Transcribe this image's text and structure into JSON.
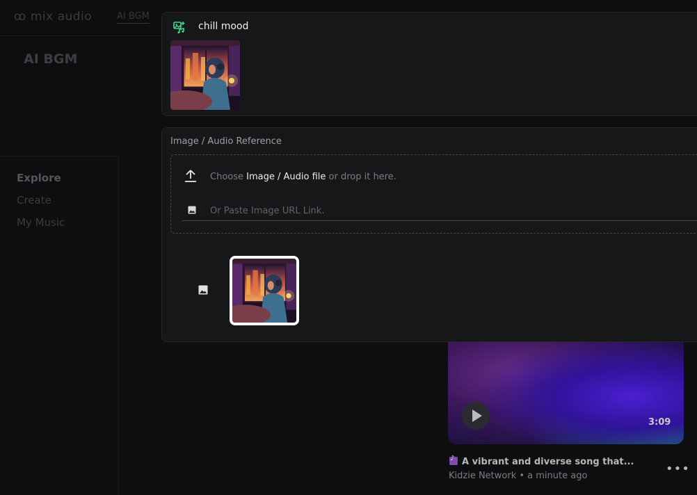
{
  "app": {
    "logo_text": "mix audio",
    "top_tab": "AI BGM",
    "page_title": "AI BGM"
  },
  "sidebar": {
    "items": [
      {
        "label": "Explore",
        "active": true
      },
      {
        "label": "Create",
        "active": false
      },
      {
        "label": "My Music",
        "active": false
      }
    ]
  },
  "mood_panel": {
    "title": "chill mood",
    "icon": "music-image-add-icon",
    "accent_color": "#3ddc97"
  },
  "reference_panel": {
    "label": "Image / Audio Reference",
    "drop_prefix": "Choose ",
    "drop_highlight": "Image / Audio file",
    "drop_suffix": " or drop it here.",
    "url_placeholder": "Or Paste Image URL Link."
  },
  "song_card": {
    "duration": "3:09",
    "title": "A vibrant and diverse song that...",
    "artist": "Kidzie Network",
    "time_ago": "a minute ago",
    "meta_separator": " • "
  }
}
